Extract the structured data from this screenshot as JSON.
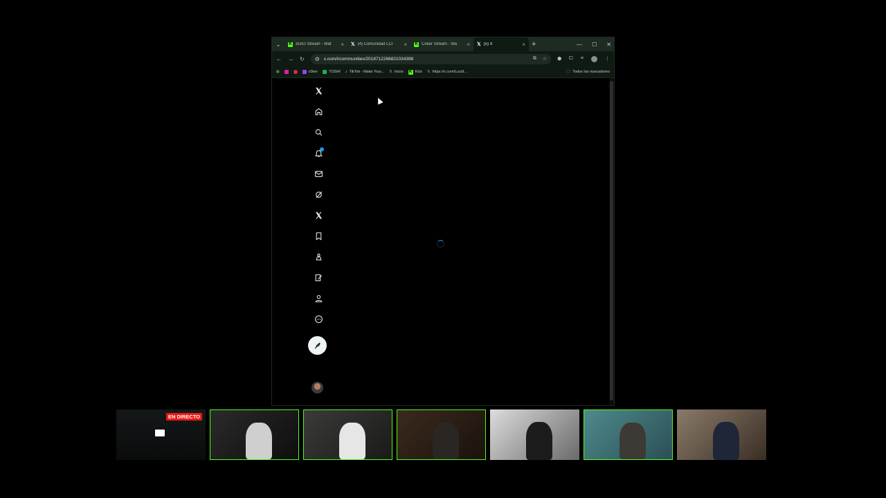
{
  "browser": {
    "tabs": [
      {
        "label": "zEkO Stream - Wat",
        "favicon": "kick-icon",
        "active": false
      },
      {
        "label": "(4) Comunidad LCI",
        "favicon": "x-icon",
        "active": false
      },
      {
        "label": "Coker Stream - Wa",
        "favicon": "kick-icon",
        "active": false
      },
      {
        "label": "(5) X",
        "favicon": "x-icon",
        "active": true
      }
    ],
    "new_tab": "+",
    "url": "x.com/i/communities/2018712266821034398",
    "bookmarks": [
      {
        "label": "",
        "icon": "instagram-icon"
      },
      {
        "label": "",
        "icon": "red-dot-icon"
      },
      {
        "label": "c0ker",
        "icon": "twitch-icon"
      },
      {
        "label": "TOSHI",
        "icon": "green-square-icon"
      },
      {
        "label": "TikTok - Make Your...",
        "icon": "tiktok-icon"
      },
      {
        "label": "Inicio",
        "icon": "x-icon"
      },
      {
        "label": "Kick",
        "icon": "kick-icon"
      },
      {
        "label": "https://x.com/Lucid...",
        "icon": "x-icon"
      }
    ],
    "all_bookmarks": "Todos los marcadores"
  },
  "x_nav": [
    "x-logo",
    "home",
    "explore",
    "notifications",
    "messages",
    "grok",
    "premium",
    "bookmarks",
    "communities",
    "verified-orgs",
    "profile",
    "more"
  ],
  "streams": {
    "live_label": "EN DIRECTO"
  },
  "colors": {
    "accent": "#1d9bf0",
    "kick_green": "#53fc18",
    "chrome_frame": "#1e2b22",
    "live_red": "#e91916"
  }
}
